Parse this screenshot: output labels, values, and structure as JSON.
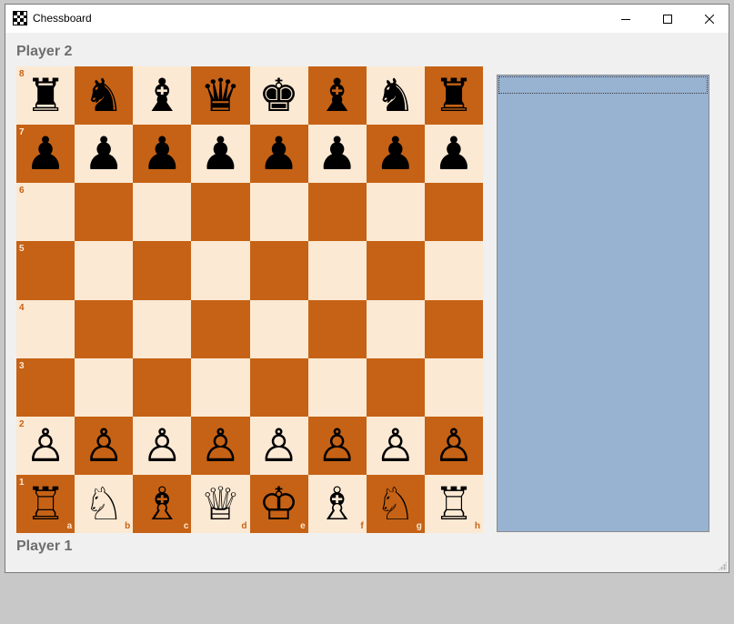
{
  "window": {
    "title": "Chessboard",
    "controls": {
      "minimize": "minimize",
      "maximize": "maximize",
      "close": "close"
    }
  },
  "players": {
    "top": "Player 2",
    "bottom": "Player 1"
  },
  "board": {
    "colors": {
      "light": "#fbe9d3",
      "dark": "#c66215"
    },
    "ranks": [
      "8",
      "7",
      "6",
      "5",
      "4",
      "3",
      "2",
      "1"
    ],
    "files": [
      "a",
      "b",
      "c",
      "d",
      "e",
      "f",
      "g",
      "h"
    ],
    "pieces": {
      "a8": "♜",
      "b8": "♞",
      "c8": "♝",
      "d8": "♛",
      "e8": "♚",
      "f8": "♝",
      "g8": "♞",
      "h8": "♜",
      "a7": "♟",
      "b7": "♟",
      "c7": "♟",
      "d7": "♟",
      "e7": "♟",
      "f7": "♟",
      "g7": "♟",
      "h7": "♟",
      "a2": "♙",
      "b2": "♙",
      "c2": "♙",
      "d2": "♙",
      "e2": "♙",
      "f2": "♙",
      "g2": "♙",
      "h2": "♙",
      "a1": "♖",
      "b1": "♘",
      "c1": "♗",
      "d1": "♕",
      "e1": "♔",
      "f1": "♗",
      "g1": "♘",
      "h1": "♖"
    },
    "piece_names": {
      "♜": "black-rook",
      "♞": "black-knight",
      "♝": "black-bishop",
      "♛": "black-queen",
      "♚": "black-king",
      "♟": "black-pawn",
      "♖": "white-rook",
      "♘": "white-knight",
      "♗": "white-bishop",
      "♕": "white-queen",
      "♔": "white-king",
      "♙": "white-pawn"
    }
  },
  "side_panel": {
    "color": "#98b2d1"
  }
}
